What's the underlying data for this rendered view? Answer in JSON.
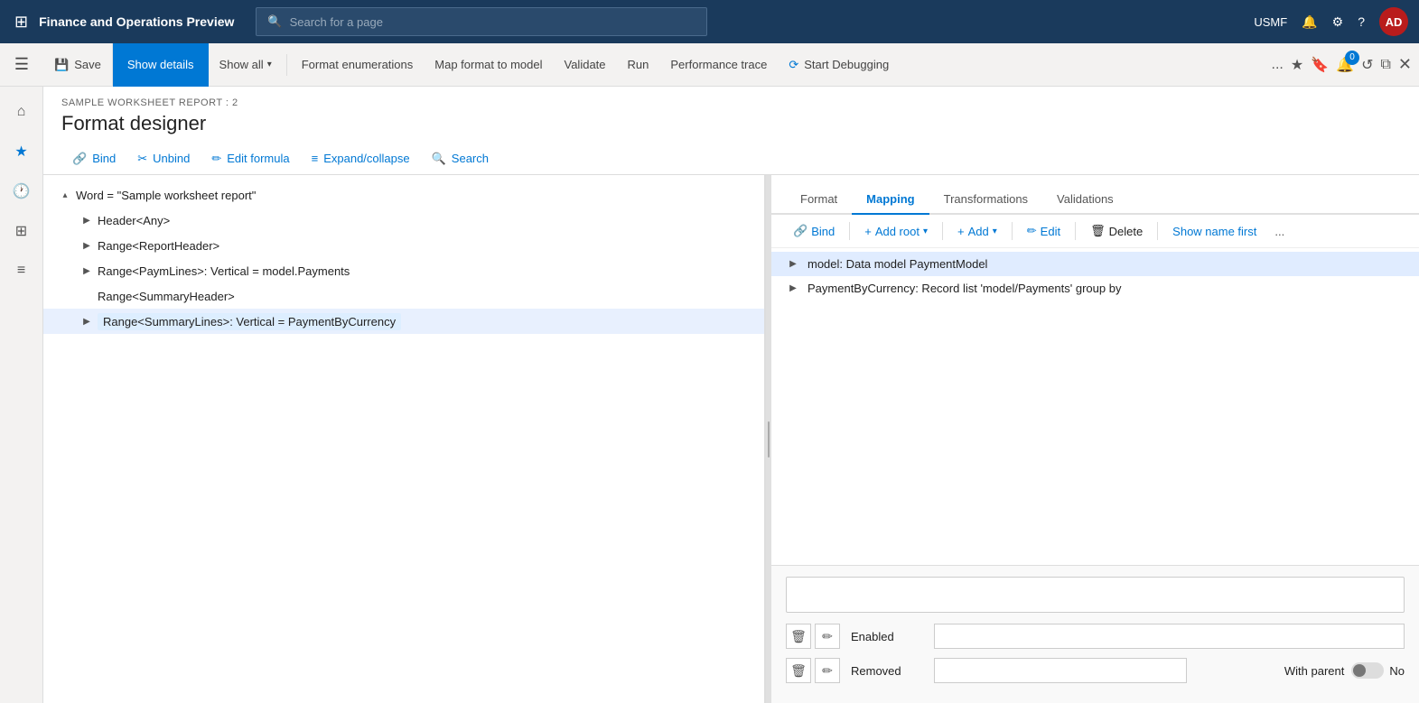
{
  "app": {
    "title": "Finance and Operations Preview",
    "user": "USMF",
    "user_badge": "AD"
  },
  "search": {
    "placeholder": "Search for a page"
  },
  "toolbar": {
    "save_label": "Save",
    "show_details_label": "Show details",
    "show_all_label": "Show all",
    "format_enumerations_label": "Format enumerations",
    "map_format_label": "Map format to model",
    "validate_label": "Validate",
    "run_label": "Run",
    "performance_trace_label": "Performance trace",
    "start_debugging_label": "Start Debugging",
    "more_label": "...",
    "notification_count": "0"
  },
  "page": {
    "breadcrumb": "SAMPLE WORKSHEET REPORT : 2",
    "title": "Format designer"
  },
  "sub_toolbar": {
    "bind_label": "Bind",
    "unbind_label": "Unbind",
    "edit_formula_label": "Edit formula",
    "expand_collapse_label": "Expand/collapse",
    "search_label": "Search"
  },
  "tree": {
    "items": [
      {
        "id": "word",
        "text": "Word = \"Sample worksheet report\"",
        "level": 0,
        "toggle": "▴",
        "selected": false
      },
      {
        "id": "header",
        "text": "Header<Any>",
        "level": 1,
        "toggle": "▶",
        "selected": false
      },
      {
        "id": "range_report",
        "text": "Range<ReportHeader>",
        "level": 1,
        "toggle": "▶",
        "selected": false
      },
      {
        "id": "range_paym",
        "text": "Range<PaymLines>: Vertical = model.Payments",
        "level": 1,
        "toggle": "▶",
        "selected": false
      },
      {
        "id": "range_summary_header",
        "text": "Range<SummaryHeader>",
        "level": 1,
        "toggle": "",
        "selected": false
      },
      {
        "id": "range_summary_lines",
        "text": "Range<SummaryLines>: Vertical = PaymentByCurrency",
        "level": 1,
        "toggle": "▶",
        "selected": true
      }
    ]
  },
  "right_pane": {
    "tabs": [
      {
        "id": "format",
        "label": "Format",
        "active": false
      },
      {
        "id": "mapping",
        "label": "Mapping",
        "active": true
      },
      {
        "id": "transformations",
        "label": "Transformations",
        "active": false
      },
      {
        "id": "validations",
        "label": "Validations",
        "active": false
      }
    ],
    "toolbar": {
      "bind_label": "Bind",
      "add_root_label": "Add root",
      "add_label": "Add",
      "edit_label": "Edit",
      "delete_label": "Delete",
      "show_name_first_label": "Show name first",
      "more_label": "..."
    },
    "mapping_items": [
      {
        "id": "model",
        "text": "model: Data model PaymentModel",
        "toggle": "▶",
        "selected": true
      },
      {
        "id": "payment_by_currency",
        "text": "PaymentByCurrency: Record list 'model/Payments' group by",
        "toggle": "▶",
        "selected": false
      }
    ]
  },
  "bottom": {
    "enabled_label": "Enabled",
    "removed_label": "Removed",
    "with_parent_label": "With parent",
    "no_label": "No"
  }
}
